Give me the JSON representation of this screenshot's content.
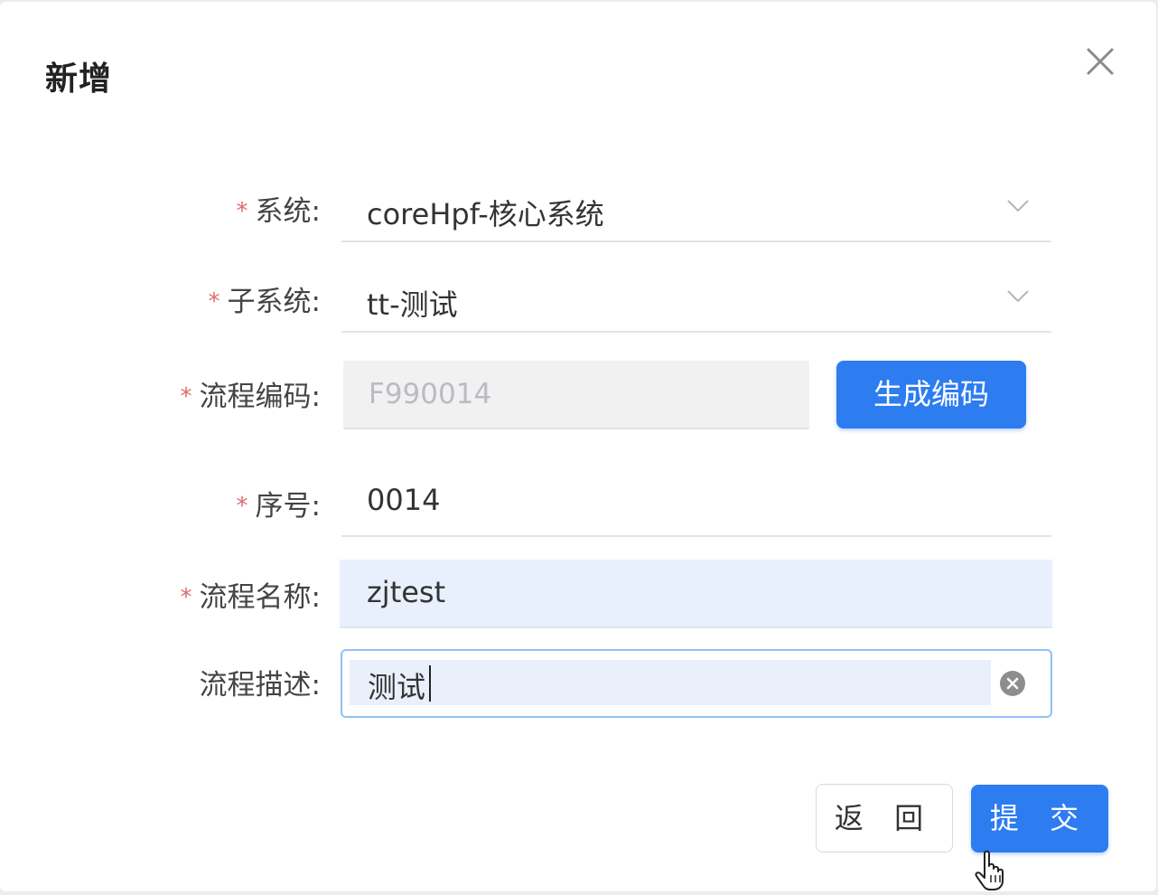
{
  "dialog": {
    "title": "新增",
    "close_icon": "close-icon"
  },
  "form": {
    "system": {
      "label": "系统:",
      "required_mark": "*",
      "value": "coreHpf-核心系统",
      "icon": "chevron-down-icon"
    },
    "subsystem": {
      "label": "子系统:",
      "required_mark": "*",
      "value": "tt-测试",
      "icon": "chevron-down-icon"
    },
    "flow_code": {
      "label": "流程编码:",
      "required_mark": "*",
      "value": "F990014",
      "button_label": "生成编码"
    },
    "sequence": {
      "label": "序号:",
      "required_mark": "*",
      "value": "0014"
    },
    "flow_name": {
      "label": "流程名称:",
      "required_mark": "*",
      "value": "zjtest"
    },
    "flow_desc": {
      "label": "流程描述:",
      "value": "测试",
      "clear_icon": "clear-circle-icon"
    }
  },
  "footer": {
    "back_label": "返 回",
    "submit_label": "提 交"
  },
  "colors": {
    "primary": "#2d7cf0",
    "required": "#e06a6a",
    "focus_border": "#8fc1f3"
  }
}
